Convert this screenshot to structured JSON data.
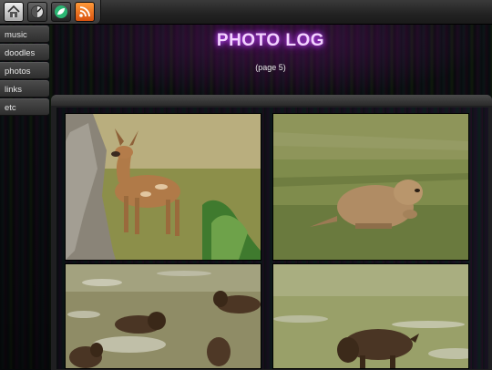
{
  "toolbar": {
    "buttons": [
      {
        "icon": "home-icon"
      },
      {
        "icon": "dial-icon"
      },
      {
        "icon": "leaf-icon"
      },
      {
        "icon": "rss-icon"
      }
    ]
  },
  "menu": {
    "items": [
      {
        "label": "music"
      },
      {
        "label": "doodles"
      },
      {
        "label": "photos"
      },
      {
        "label": "links"
      },
      {
        "label": "etc"
      }
    ]
  },
  "header": {
    "title": "PHOTO LOG",
    "subtitle": "(page 5)"
  },
  "gallery": {
    "photos": [
      {
        "subject": "deer"
      },
      {
        "subject": "prairie-dog"
      },
      {
        "subject": "bison-herd"
      },
      {
        "subject": "bison"
      }
    ]
  },
  "colors": {
    "title_glow": "#c04cff",
    "rss_orange": "#f07a22",
    "leaf_green": "#2bb673"
  }
}
